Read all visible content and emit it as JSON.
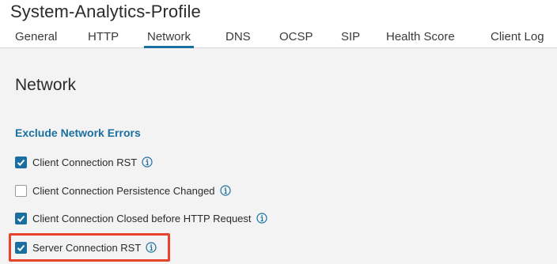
{
  "header": {
    "title": "System-Analytics-Profile",
    "tabs": [
      {
        "label": "General"
      },
      {
        "label": "HTTP"
      },
      {
        "label": "Network",
        "active": true
      },
      {
        "label": "DNS"
      },
      {
        "label": "OCSP"
      },
      {
        "label": "SIP"
      },
      {
        "label": "Health Score"
      },
      {
        "label": "Client Log"
      }
    ]
  },
  "section": {
    "title": "Network",
    "subsection_title": "Exclude Network Errors",
    "options": [
      {
        "label": "Client Connection RST",
        "checked": true
      },
      {
        "label": "Client Connection Persistence Changed",
        "checked": false
      },
      {
        "label": "Client Connection Closed before HTTP Request",
        "checked": true
      },
      {
        "label": "Server Connection RST",
        "checked": true,
        "highlighted": true
      }
    ]
  },
  "colors": {
    "accent": "#1b6fa0",
    "highlight": "#e8442d",
    "background": "#f3f3f3"
  },
  "icons": {
    "checkbox_checked": "check-icon",
    "info": "info-icon"
  }
}
